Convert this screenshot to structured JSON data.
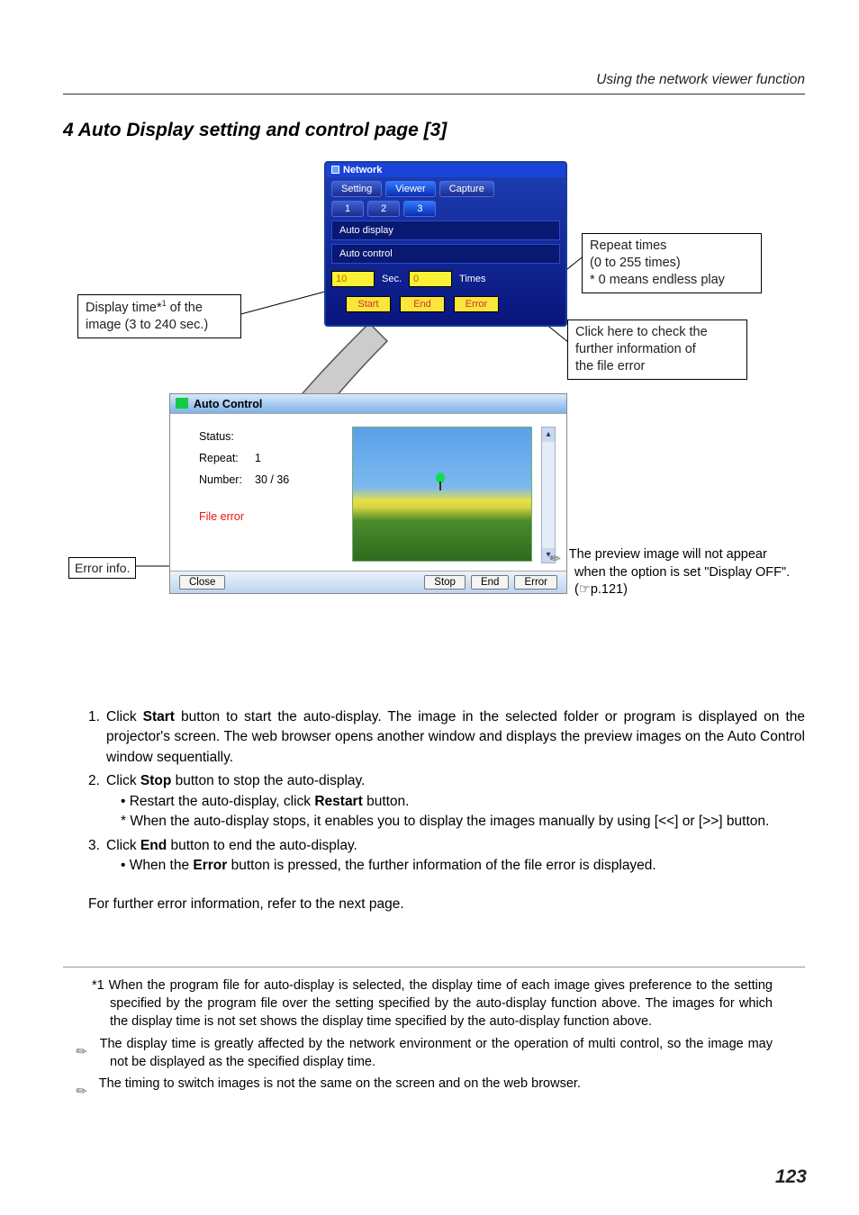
{
  "running_head": "Using the network viewer function",
  "section_title": "4 Auto Display setting and control page [3]",
  "net": {
    "window_title": "Network",
    "tabs_main": [
      "Setting",
      "Viewer",
      "Capture"
    ],
    "tabs_sub": [
      "1",
      "2",
      "3"
    ],
    "menu1": "Auto display",
    "menu2": "Auto control",
    "sec_value": "10",
    "sec_label": "Sec.",
    "times_value": "0",
    "times_label": "Times",
    "btn_start": "Start",
    "btn_end": "End",
    "btn_error": "Error"
  },
  "callouts": {
    "display_time_l1": "Display time*",
    "display_time_sup": "1",
    "display_time_l1b": " of the",
    "display_time_l2": "image (3 to 240 sec.)",
    "repeat_l1": "Repeat times",
    "repeat_l2": "(0 to 255 times)",
    "repeat_l3": "* 0 means endless play",
    "error_click_l1": "Click here to check the",
    "error_click_l2": "further information of",
    "error_click_l3": "the file error",
    "error_info": "Error info."
  },
  "ac": {
    "title": "Auto Control",
    "status_label": "Status:",
    "repeat_label": "Repeat:",
    "repeat_value": "1",
    "number_label": "Number:",
    "number_value": "30 / 36",
    "file_error": "File error",
    "btn_close": "Close",
    "btn_stop": "Stop",
    "btn_end": "End",
    "btn_error": "Error"
  },
  "note_right": " The preview image will not appear when the option is set \"Display OFF\".(☞p.121)",
  "steps": {
    "s1a": "Click ",
    "s1b": "Start",
    "s1c": " button to start the auto-display. The image in the selected folder or program is displayed on the projector's screen. The web browser opens another window and displays the preview images on the Auto Control window sequentially.",
    "s2a": "Click ",
    "s2b": "Stop",
    "s2c": " button to stop the auto-display.",
    "s2s1a": "• Restart the auto-display, click ",
    "s2s1b": "Restart",
    "s2s1c": " button.",
    "s2s2": "* When the auto-display stops, it enables you to display the images manually by using [<<] or [>>] button.",
    "s3a": "Click ",
    "s3b": "End",
    "s3c": " button to end the auto-display.",
    "s3s1a": "• When the ",
    "s3s1b": "Error",
    "s3s1c": " button is pressed, the further information of the file error is displayed."
  },
  "para_more": "For further error information, refer to the next page.",
  "footnotes": {
    "f1": "*1 When the program file for auto-display is selected, the display time of each image gives preference to the setting specified by the program file over the setting specified by the auto-display function above. The images for which the display time is not set shows the display time specified by the auto-display function above.",
    "f2": " The display time is greatly affected by the network environment or the operation of multi control, so the image may not be displayed as the specified display time.",
    "f3": " The timing to switch images is not the same on the screen and on the web browser."
  },
  "page_number": "123"
}
